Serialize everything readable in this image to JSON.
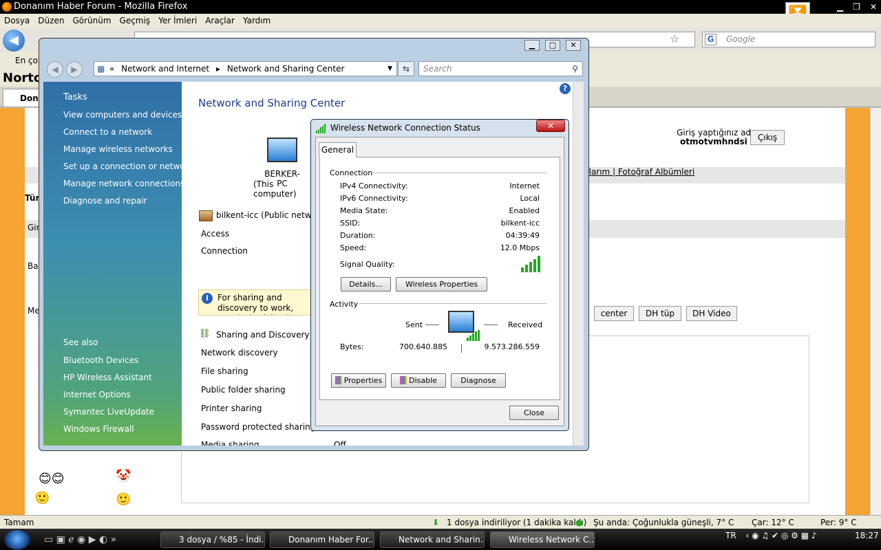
{
  "firefox": {
    "title": "Donanım Haber Forum - Mozilla Firefox",
    "menu": [
      "Dosya",
      "Düzen",
      "Görünüm",
      "Geçmiş",
      "Yer İmleri",
      "Araçlar",
      "Yardım"
    ],
    "search_placeholder": "Google",
    "bookmarks_text": "En çok",
    "norton_label": "Norto",
    "tab_label": "Dona",
    "status_left": "Tamam",
    "download_status": "1 dosya indiriliyor (1 dakika kaldı)",
    "weather_now": "Şu anda: Çoğunlukla güneşli, 7° C",
    "weather_wed": "Çar: 12° C",
    "weather_thu": "Per: 9° C"
  },
  "webpage": {
    "login_label": "Giriş yaptığınız ad",
    "login_user": "otmotvmhndsi",
    "logout_button": "Çıkış",
    "links": "nlarım | Fotoğraf Albümleri",
    "section_label": "Tür",
    "side_labels": [
      "Gir",
      "Ba",
      "Me"
    ],
    "nav_buttons": [
      "center",
      "DH tüp",
      "DH Video"
    ]
  },
  "network_center": {
    "breadcrumb_root": "«",
    "breadcrumb": [
      "Network and Internet",
      "Network and Sharing Center"
    ],
    "search_placeholder": "Search",
    "tasks_title": "Tasks",
    "tasks": [
      "View computers and devices",
      "Connect to a network",
      "Manage wireless networks",
      "Set up a connection or network",
      "Manage network connections",
      "Diagnose and repair"
    ],
    "see_also_title": "See also",
    "see_also": [
      "Bluetooth Devices",
      "HP Wireless Assistant",
      "Internet Options",
      "Symantec LiveUpdate",
      "Windows Firewall"
    ],
    "title": "Network and Sharing Center",
    "computer_name": "BERKER-PC",
    "computer_sub": "(This computer)",
    "network_name": "bilkent-icc (Public network)",
    "access_label": "Access",
    "connection_label": "Connection",
    "info_text": "For sharing and discovery to work, match the following settings",
    "sharing_title": "Sharing and Discovery",
    "sharing_items": [
      "Network discovery",
      "File sharing",
      "Public folder sharing",
      "Printer sharing",
      "Password protected sharing",
      "Media sharing"
    ],
    "media_sharing_value": "Off"
  },
  "status_dialog": {
    "title": "Wireless Network Connection Status",
    "tab": "General",
    "connection_group": "Connection",
    "rows": [
      {
        "label": "IPv4 Connectivity:",
        "value": "Internet"
      },
      {
        "label": "IPv6 Connectivity:",
        "value": "Local"
      },
      {
        "label": "Media State:",
        "value": "Enabled"
      },
      {
        "label": "SSID:",
        "value": "bilkent-icc"
      },
      {
        "label": "Duration:",
        "value": "04:39:49"
      },
      {
        "label": "Speed:",
        "value": "12.0 Mbps"
      }
    ],
    "signal_label": "Signal Quality:",
    "signal_bars": 5,
    "details_button": "Details...",
    "wireless_props_button": "Wireless Properties",
    "activity_group": "Activity",
    "sent_label": "Sent",
    "received_label": "Received",
    "bytes_label": "Bytes:",
    "bytes_sent": "700.640.885",
    "bytes_received": "9.573.286.559",
    "properties_button": "Properties",
    "disable_button": "Disable",
    "diagnose_button": "Diagnose",
    "close_button": "Close"
  },
  "taskbar": {
    "buttons": [
      "3 dosya / %85 - İndi...",
      "Donanım Haber For...",
      "Network and Sharin...",
      "Wireless Network C..."
    ],
    "lang": "TR",
    "time": "18:27"
  }
}
